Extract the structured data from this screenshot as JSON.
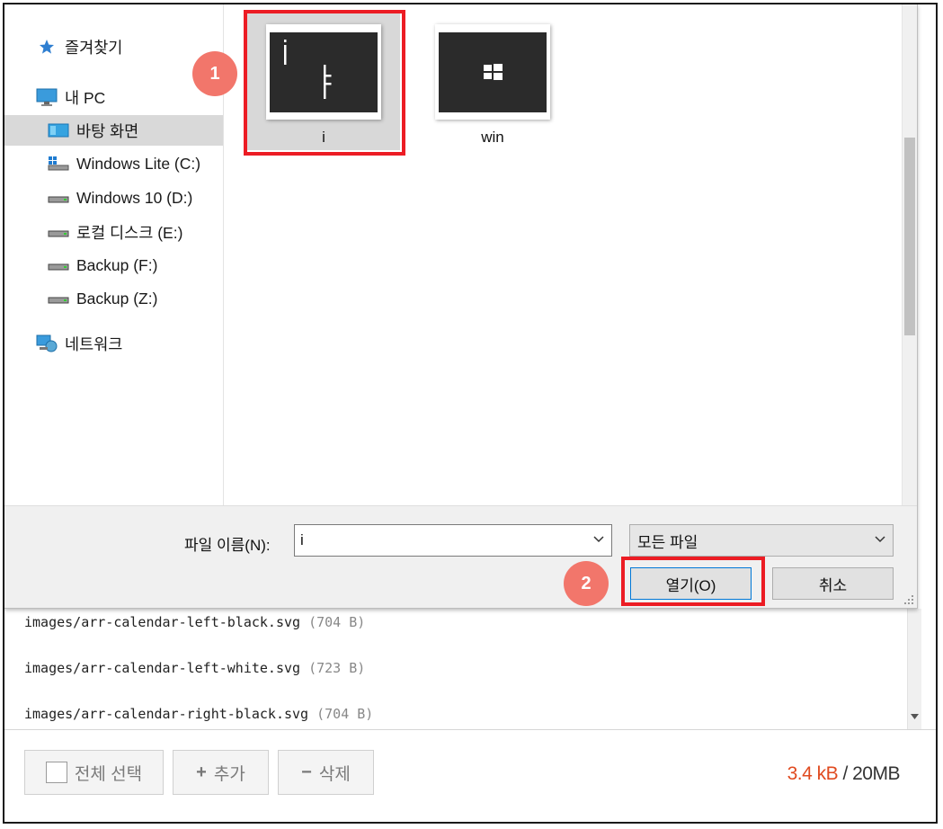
{
  "dialog": {
    "nav": [
      {
        "label": "즐겨찾기",
        "icon": "star-icon"
      },
      {
        "label": "내 PC",
        "icon": "computer-icon"
      },
      {
        "label": "바탕 화면",
        "icon": "desktop-folder-icon"
      },
      {
        "label": "Windows Lite (C:)",
        "icon": "windows-drive-icon"
      },
      {
        "label": "Windows 10 (D:)",
        "icon": "drive-icon"
      },
      {
        "label": "로컬 디스크 (E:)",
        "icon": "drive-icon"
      },
      {
        "label": "Backup (F:)",
        "icon": "drive-icon"
      },
      {
        "label": "Backup (Z:)",
        "icon": "drive-icon"
      },
      {
        "label": "네트워크",
        "icon": "network-icon"
      }
    ],
    "files": [
      {
        "name": "i"
      },
      {
        "name": "win"
      }
    ],
    "filename_label": "파일 이름(N):",
    "filename_value": "i",
    "filetype_value": "모든 파일",
    "open_label": "열기(O)",
    "cancel_label": "취소"
  },
  "annotations": {
    "step1": "1",
    "step2": "2",
    "highlight_color": "#ec1c24",
    "badge_color": "#f2766b"
  },
  "background": {
    "files": [
      {
        "path": "images/arr-calendar-left-black.svg",
        "size": "(704 B)"
      },
      {
        "path": "images/arr-calendar-left-white.svg",
        "size": "(723 B)"
      },
      {
        "path": "images/arr-calendar-right-black.svg",
        "size": "(704 B)"
      }
    ],
    "select_all_label": "전체 선택",
    "add_label": "추가",
    "delete_label": "삭제",
    "quota_used": "3.4 kB",
    "quota_total": " / 20MB",
    "accent_color": "#e04a1f"
  }
}
